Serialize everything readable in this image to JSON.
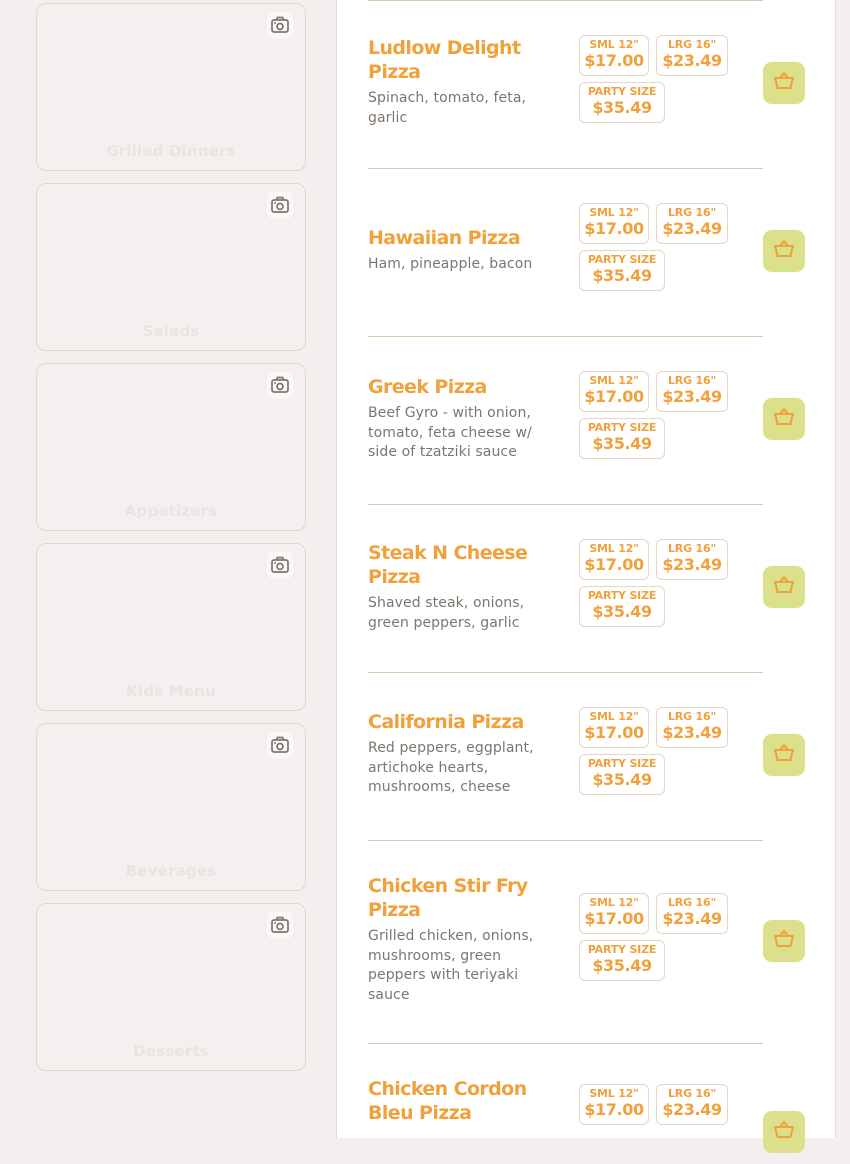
{
  "categories": [
    {
      "title": "Grilled Dinners"
    },
    {
      "title": "Salads"
    },
    {
      "title": "Appetizers"
    },
    {
      "title": "Kids Menu"
    },
    {
      "title": "Beverages"
    },
    {
      "title": "Desserts"
    }
  ],
  "price_labels": {
    "small": "SML 12\"",
    "large": "LRG 16\"",
    "party": "PARTY SIZE"
  },
  "items": [
    {
      "name": "Ludlow Delight Pizza",
      "description": "Spinach, tomato, feta, garlic",
      "small_price": "$17.00",
      "large_price": "$23.49",
      "party_price": "$35.49"
    },
    {
      "name": "Hawaiian Pizza",
      "description": "Ham, pineapple, bacon",
      "small_price": "$17.00",
      "large_price": "$23.49",
      "party_price": "$35.49"
    },
    {
      "name": "Greek Pizza",
      "description": "Beef Gyro - with onion, tomato, feta cheese w/ side of tzatziki sauce",
      "small_price": "$17.00",
      "large_price": "$23.49",
      "party_price": "$35.49"
    },
    {
      "name": "Steak N Cheese Pizza",
      "description": "Shaved steak, onions, green peppers, garlic",
      "small_price": "$17.00",
      "large_price": "$23.49",
      "party_price": "$35.49"
    },
    {
      "name": "California Pizza",
      "description": "Red peppers, eggplant, artichoke hearts, mushrooms, cheese",
      "small_price": "$17.00",
      "large_price": "$23.49",
      "party_price": "$35.49"
    },
    {
      "name": "Chicken Stir Fry Pizza",
      "description": "Grilled chicken, onions, mushrooms, green peppers with teriyaki sauce",
      "small_price": "$17.00",
      "large_price": "$23.49",
      "party_price": "$35.49"
    },
    {
      "name": "Chicken Cordon Bleu Pizza",
      "description": "",
      "small_price": "$17.00",
      "large_price": "$23.49",
      "party_price": ""
    }
  ],
  "icons": {
    "category_photo": "camera-icon",
    "add_to_cart": "basket-icon"
  },
  "colors": {
    "accent": "#f0a13c",
    "cart_button": "#dbe18a",
    "description_text": "#7e756d",
    "background": "#f3efee"
  }
}
